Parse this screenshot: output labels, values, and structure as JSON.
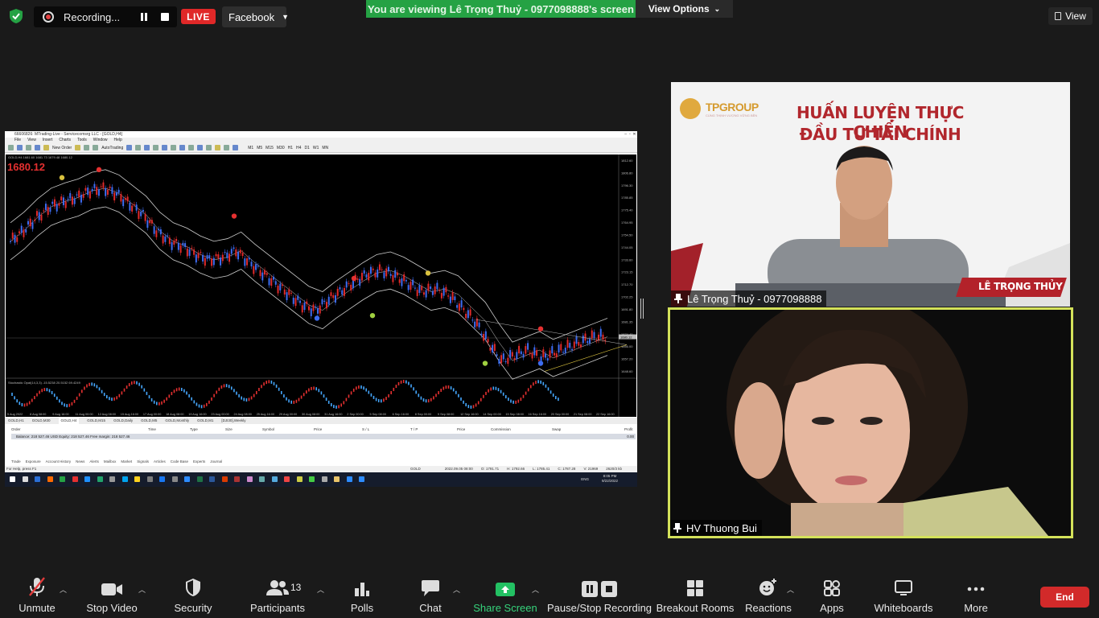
{
  "topbar": {
    "recording_label": "Recording...",
    "live_label": "LIVE",
    "facebook_label": "Facebook",
    "viewing_banner": "You are viewing Lê Trọng Thuỷ - 0977098888's screen",
    "view_options_label": "View Options",
    "view_label": "View"
  },
  "shared_screen": {
    "window_title": "66606826: MTrading-Live - Servicecomsrg LLC - [GOLD,H4]",
    "menu": [
      "File",
      "View",
      "Insert",
      "Charts",
      "Tools",
      "Window",
      "Help"
    ],
    "toolbar_new_order": "New Order",
    "toolbar_autotrading": "AutoTrading",
    "timeframes": [
      "M1",
      "M5",
      "M15",
      "M30",
      "H1",
      "H4",
      "D1",
      "W1",
      "MN"
    ],
    "chart_symbol_line": "GOLD,H4  1681.60 1681.73 1679.48 1680.12",
    "chart_price_big": "1680.12",
    "osc_label": "Stochastic Opal(14,3,3)  -15.5238 20.5152 69.4249",
    "chart_tabs": [
      "GOLD,H1",
      "GOLD,M30",
      "GOLD,H4",
      "GOLD,M15",
      "GOLD,Daily",
      "GOLD,M5",
      "GOLD,Monthly",
      "GOLD,M1",
      "[DJI30],Weekly"
    ],
    "term_headers": [
      "Order",
      "Time",
      "Type",
      "Size",
      "Symbol",
      "Price",
      "S / L",
      "T / P",
      "Price",
      "Commission",
      "Swap",
      "Profit"
    ],
    "balance_line": "Balance: 218 527.46 USD  Equity: 218 527.46  Free margin: 218 527.46",
    "balance_profit": "0.00",
    "term_tabs": [
      "Trade",
      "Exposure",
      "Account History",
      "News",
      "Alerts",
      "Mailbox",
      "Market",
      "Signals",
      "Articles",
      "Code Base",
      "Experts",
      "Journal"
    ],
    "status_left": "For Help, press F1",
    "status_symbol": "GOLD",
    "status_time": "2022.09.05 08:00",
    "status_o": "O: 1791.71",
    "status_h": "H: 1792.66",
    "status_l": "L: 1785.41",
    "status_c": "C: 1787.28",
    "status_v": "V: 21969",
    "status_kb": "2620/3 kb",
    "clock_time": "8:05 PM",
    "clock_date": "9/22/2022",
    "lang": "ENG"
  },
  "chart_data": {
    "type": "line",
    "title": "",
    "series": [
      {
        "values": [
          1752,
          1760,
          1770,
          1778,
          1782,
          1785,
          1790,
          1792,
          1788,
          1780,
          1772,
          1760,
          1752,
          1748,
          1742,
          1738,
          1740,
          1745,
          1736,
          1728,
          1720,
          1712,
          1704,
          1700,
          1708,
          1715,
          1722,
          1728,
          1730,
          1726,
          1720,
          1714,
          1716,
          1712,
          1702,
          1692,
          1676,
          1662,
          1666,
          1670,
          1664,
          1668,
          1672,
          1676,
          1680
        ]
      }
    ],
    "ylim": [
      1650,
      1815
    ],
    "yticks": [
      "1812.60",
      "1806.80",
      "1796.30",
      "1785.85",
      "1775.40",
      "1764.95",
      "1754.50",
      "1744.05",
      "1733.60",
      "1723.15",
      "1712.70",
      "1702.25",
      "1691.80",
      "1681.35",
      "1674.40",
      "1666.00",
      "1657.20",
      "1648.60"
    ],
    "xticks": [
      "5 Aug 2022",
      "8 Aug 08:00",
      "9 Aug 16:00",
      "11 Aug 00:00",
      "12 Aug 08:00",
      "15 Aug 16:00",
      "17 Aug 00:00",
      "18 Aug 08:00",
      "19 Aug 16:00",
      "23 Aug 00:00",
      "24 Aug 08:00",
      "25 Aug 16:00",
      "29 Aug 00:00",
      "30 Aug 08:00",
      "31 Aug 16:00",
      "2 Sep 00:00",
      "5 Sep 08:00",
      "6 Sep 16:00",
      "8 Sep 00:00",
      "9 Sep 08:00",
      "12 Sep 16:00",
      "14 Sep 00:00",
      "15 Sep 08:00",
      "16 Sep 16:00",
      "20 Sep 00:00",
      "21 Sep 08:00",
      "22 Sep 16:00"
    ],
    "right_price_label": "1680.12",
    "marker_labels": [
      "1680.12"
    ]
  },
  "participants": {
    "host": {
      "name": "Lê Trọng Thuỷ - 0977098888",
      "brand": "TPGROUP",
      "brand_sub": "CÙNG THỊNH VƯỢNG VỮNG BỀN",
      "headline_1": "HUẤN LUYỆN THỰC CHIẾN",
      "headline_2": "ĐẦU TƯ TÀI CHÍNH",
      "badge": "LÊ TRỌNG THỦY"
    },
    "guest": {
      "name": "HV Thuong Bui"
    }
  },
  "toolbar": {
    "unmute": "Unmute",
    "stop_video": "Stop Video",
    "security": "Security",
    "participants": "Participants",
    "participants_count": "13",
    "polls": "Polls",
    "chat": "Chat",
    "share_screen": "Share Screen",
    "pause_stop_recording": "Pause/Stop Recording",
    "breakout_rooms": "Breakout Rooms",
    "reactions": "Reactions",
    "apps": "Apps",
    "whiteboards": "Whiteboards",
    "more": "More",
    "end": "End"
  },
  "colors": {
    "live": "#e02828",
    "banner": "#25a244",
    "active_speaker": "#d4e25a",
    "end": "#d22a2a",
    "share_green": "#36d37b"
  }
}
